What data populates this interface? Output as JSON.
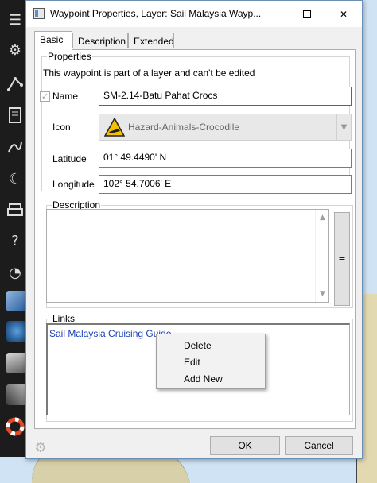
{
  "window": {
    "title": "Waypoint Properties, Layer: Sail Malaysia Wayp...",
    "controls": {
      "minimize": "minimize",
      "maximize": "maximize",
      "close": "✕"
    }
  },
  "tabs": [
    {
      "label": "Basic",
      "active": true
    },
    {
      "label": "Description",
      "active": false
    },
    {
      "label": "Extended",
      "active": false
    }
  ],
  "properties": {
    "group_label": "Properties",
    "notice": "This waypoint is part of a layer and can't be edited",
    "name_label": "Name",
    "name_checked": true,
    "name_value": "SM-2.14-Batu Pahat Crocs",
    "icon_label": "Icon",
    "icon_value": "Hazard-Animals-Crocodile",
    "icon_glyph": "hazard-crocodile-icon",
    "latitude_label": "Latitude",
    "latitude_value": "01° 49.4490' N",
    "longitude_label": "Longitude",
    "longitude_value": "102° 54.7006' E"
  },
  "description": {
    "group_label": "Description",
    "value": "",
    "side_button": "≡"
  },
  "links": {
    "group_label": "Links",
    "items": [
      "Sail Malaysia Cruising Guide"
    ]
  },
  "context_menu": {
    "items": [
      "Delete",
      "Edit",
      "Add New"
    ]
  },
  "footer": {
    "ok_label": "OK",
    "cancel_label": "Cancel"
  },
  "colors": {
    "link": "#1a3fb5",
    "accent_border": "#2f6fb0",
    "toolbar_bg": "#1c1c1c"
  }
}
